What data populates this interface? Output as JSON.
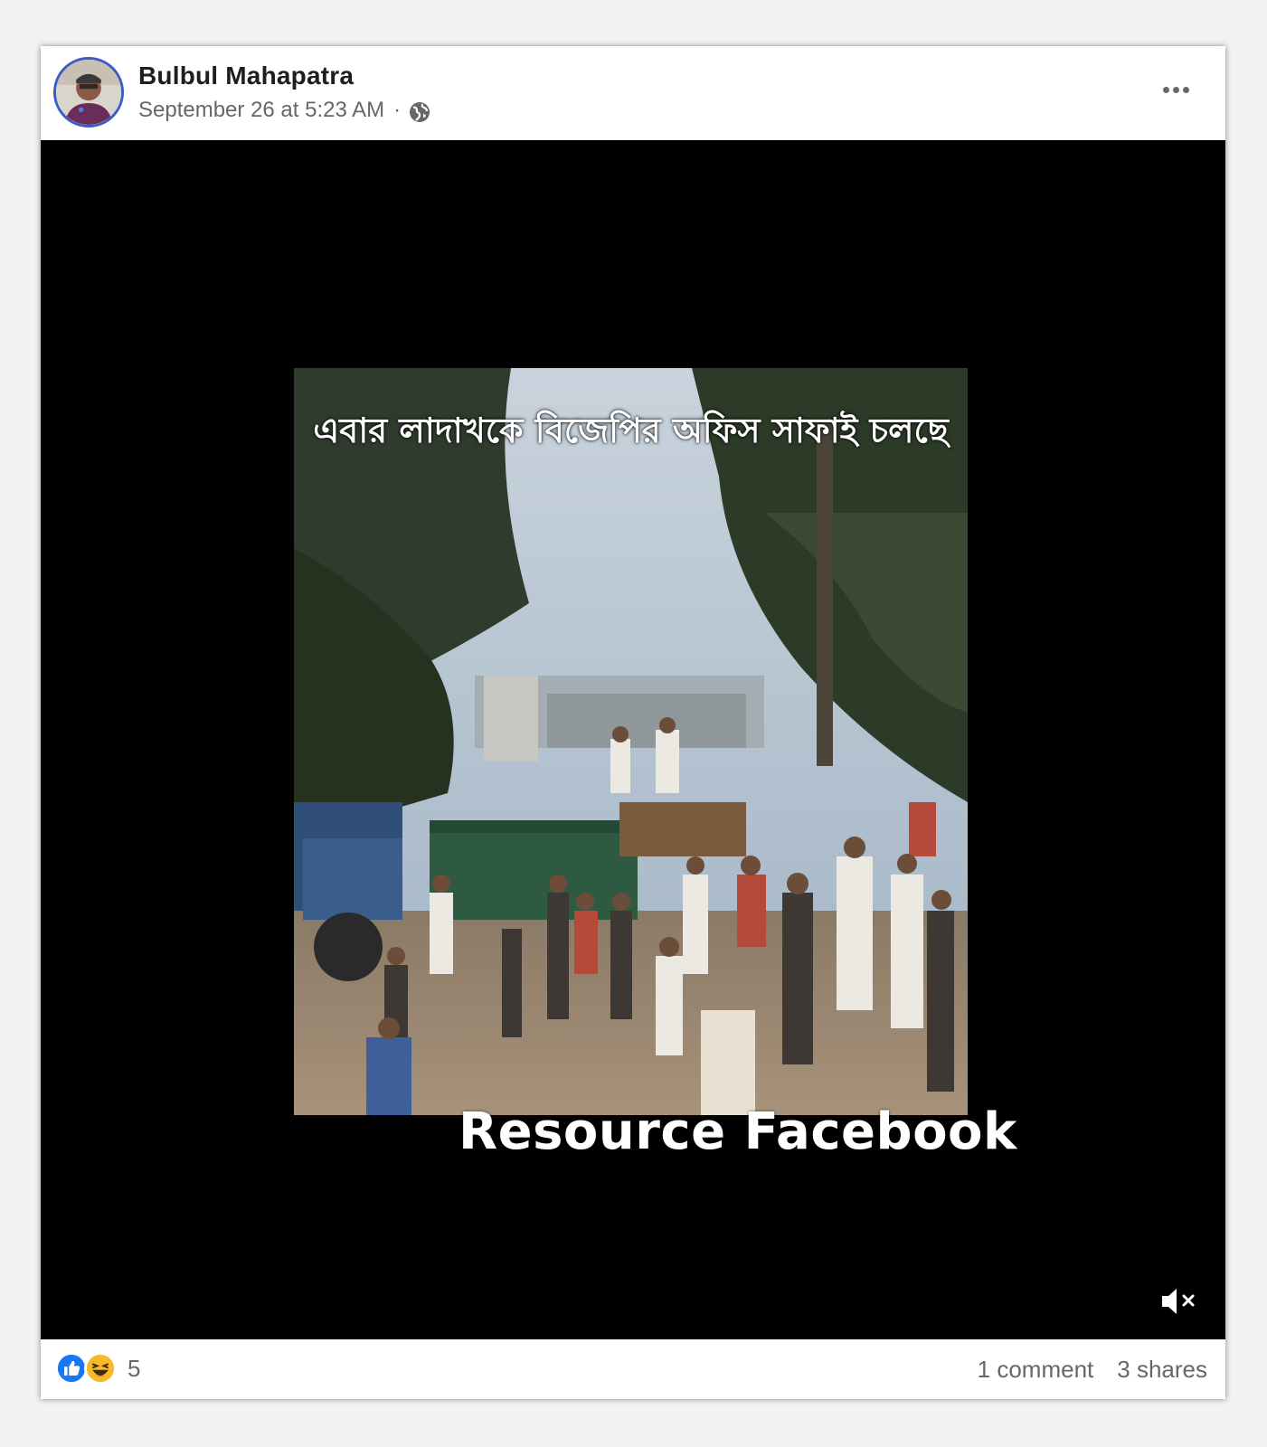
{
  "post": {
    "author": "Bulbul Mahapatra",
    "timestamp": "September 26 at 5:23 AM",
    "separator": "·",
    "privacy_icon": "globe-icon",
    "more_icon": "more-options-icon"
  },
  "video": {
    "caption": "এবার লাদাখকে  বিজেপির অফিস সাফাই চলছে",
    "watermark": "Resource Facebook",
    "mute_icon": "volume-muted-icon"
  },
  "footer": {
    "reaction_icons": [
      "like-icon",
      "haha-icon"
    ],
    "reaction_count": "5",
    "comments": "1 comment",
    "shares": "3 shares"
  },
  "colors": {
    "like_blue": "#1877f2",
    "haha_yellow": "#f7b928",
    "avatar_ring": "#3b5cc4",
    "secondary_text": "#65676b"
  }
}
